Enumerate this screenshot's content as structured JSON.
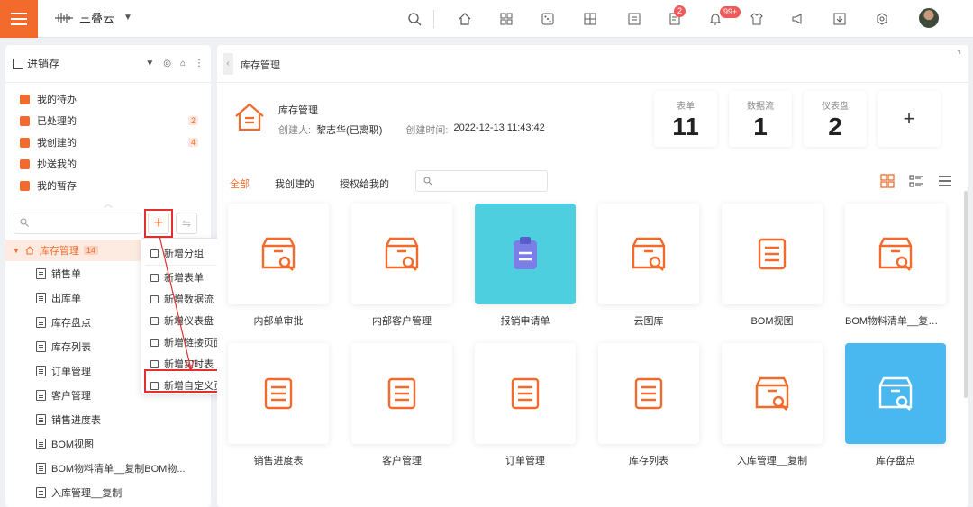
{
  "topbar": {
    "app_title": "三叠云",
    "badges": {
      "notices": "2",
      "bell": "99+"
    }
  },
  "sidebar": {
    "workspace": "进销存",
    "quick": [
      {
        "label": "我的待办",
        "count": ""
      },
      {
        "label": "已处理的",
        "count": "2"
      },
      {
        "label": "我创建的",
        "count": "4"
      },
      {
        "label": "抄送我的",
        "count": ""
      },
      {
        "label": "我的暂存",
        "count": ""
      }
    ],
    "add_symbol": "+",
    "tree_root": {
      "label": "库存管理",
      "count": "14"
    },
    "tree": [
      "销售单",
      "出库单",
      "库存盘点",
      "库存列表",
      "订单管理",
      "客户管理",
      "销售进度表",
      "BOM视图",
      "BOM物料清单__复制BOM物...",
      "入库管理__复制"
    ]
  },
  "context_menu": [
    "新增分组",
    "新增表单",
    "新增数据流",
    "新增仪表盘",
    "新增链接页面",
    "新增实时表",
    "新增自定义页面"
  ],
  "main": {
    "tab_title": "库存管理",
    "info": {
      "title": "库存管理",
      "creator_label": "创建人:",
      "creator": "黎志华(已离职)",
      "created_label": "创建时间:",
      "created": "2022-12-13 11:43:42"
    },
    "stats": [
      {
        "label": "表单",
        "value": "11"
      },
      {
        "label": "数据流",
        "value": "1"
      },
      {
        "label": "仪表盘",
        "value": "2"
      }
    ],
    "stat_add": "+",
    "filters": [
      "全部",
      "我创建的",
      "授权给我的"
    ],
    "cards": [
      {
        "label": "内部单审批",
        "icon": "box-search-icon",
        "bg": "#ffffff"
      },
      {
        "label": "内部客户管理",
        "icon": "box-search-icon",
        "bg": "#ffffff"
      },
      {
        "label": "报销申请单",
        "icon": "clipboard-icon",
        "bg": "#4ecfe0"
      },
      {
        "label": "云图库",
        "icon": "box-search-icon",
        "bg": "#ffffff"
      },
      {
        "label": "BOM视图",
        "icon": "document-icon",
        "bg": "#ffffff"
      },
      {
        "label": "BOM物料清单__复制...",
        "icon": "box-search-icon",
        "bg": "#ffffff"
      },
      {
        "label": "销售进度表",
        "icon": "document-icon",
        "bg": "#ffffff"
      },
      {
        "label": "客户管理",
        "icon": "document-icon",
        "bg": "#ffffff"
      },
      {
        "label": "订单管理",
        "icon": "document-icon",
        "bg": "#ffffff"
      },
      {
        "label": "库存列表",
        "icon": "document-icon",
        "bg": "#ffffff"
      },
      {
        "label": "入库管理__复制",
        "icon": "box-search-icon",
        "bg": "#ffffff"
      },
      {
        "label": "库存盘点",
        "icon": "box-search-icon",
        "bg": "#4ab8f0"
      }
    ],
    "accent": "#f26b2c"
  }
}
